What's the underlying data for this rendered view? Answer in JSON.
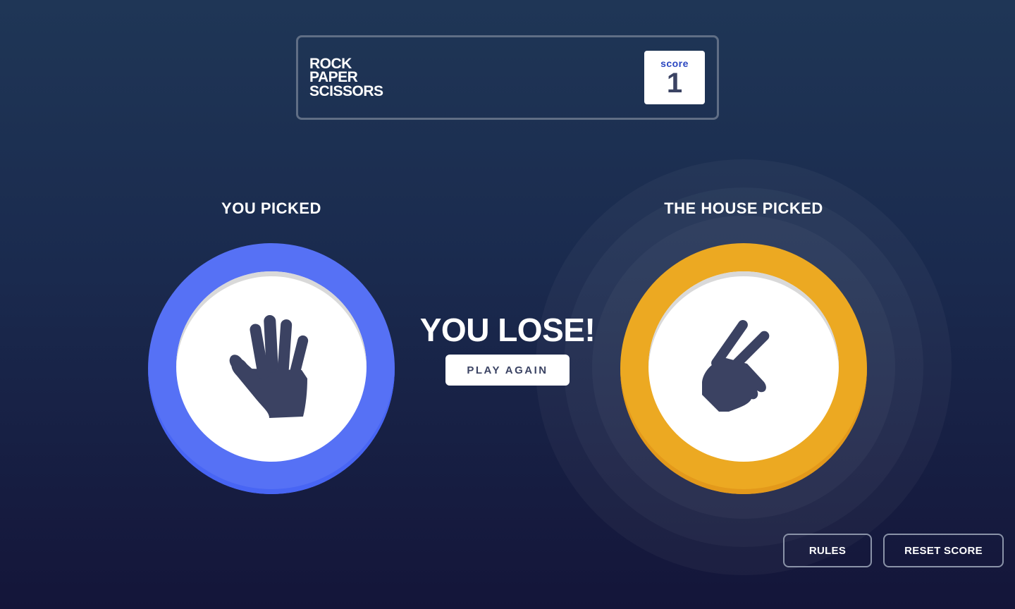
{
  "header": {
    "title_lines": [
      "ROCK",
      "PAPER",
      "SCISSORS"
    ],
    "score_label": "score",
    "score_value": "1"
  },
  "player": {
    "label": "YOU PICKED",
    "choice": "paper",
    "icon": "paper-hand-icon",
    "color": "#5671f5"
  },
  "house": {
    "label": "THE HOUSE PICKED",
    "choice": "scissors",
    "icon": "scissors-hand-icon",
    "color": "#eca922",
    "winner": true
  },
  "result": {
    "text": "YOU LOSE!",
    "play_again_label": "PLAY AGAIN"
  },
  "footer": {
    "rules_label": "RULES",
    "reset_label": "RESET SCORE"
  }
}
